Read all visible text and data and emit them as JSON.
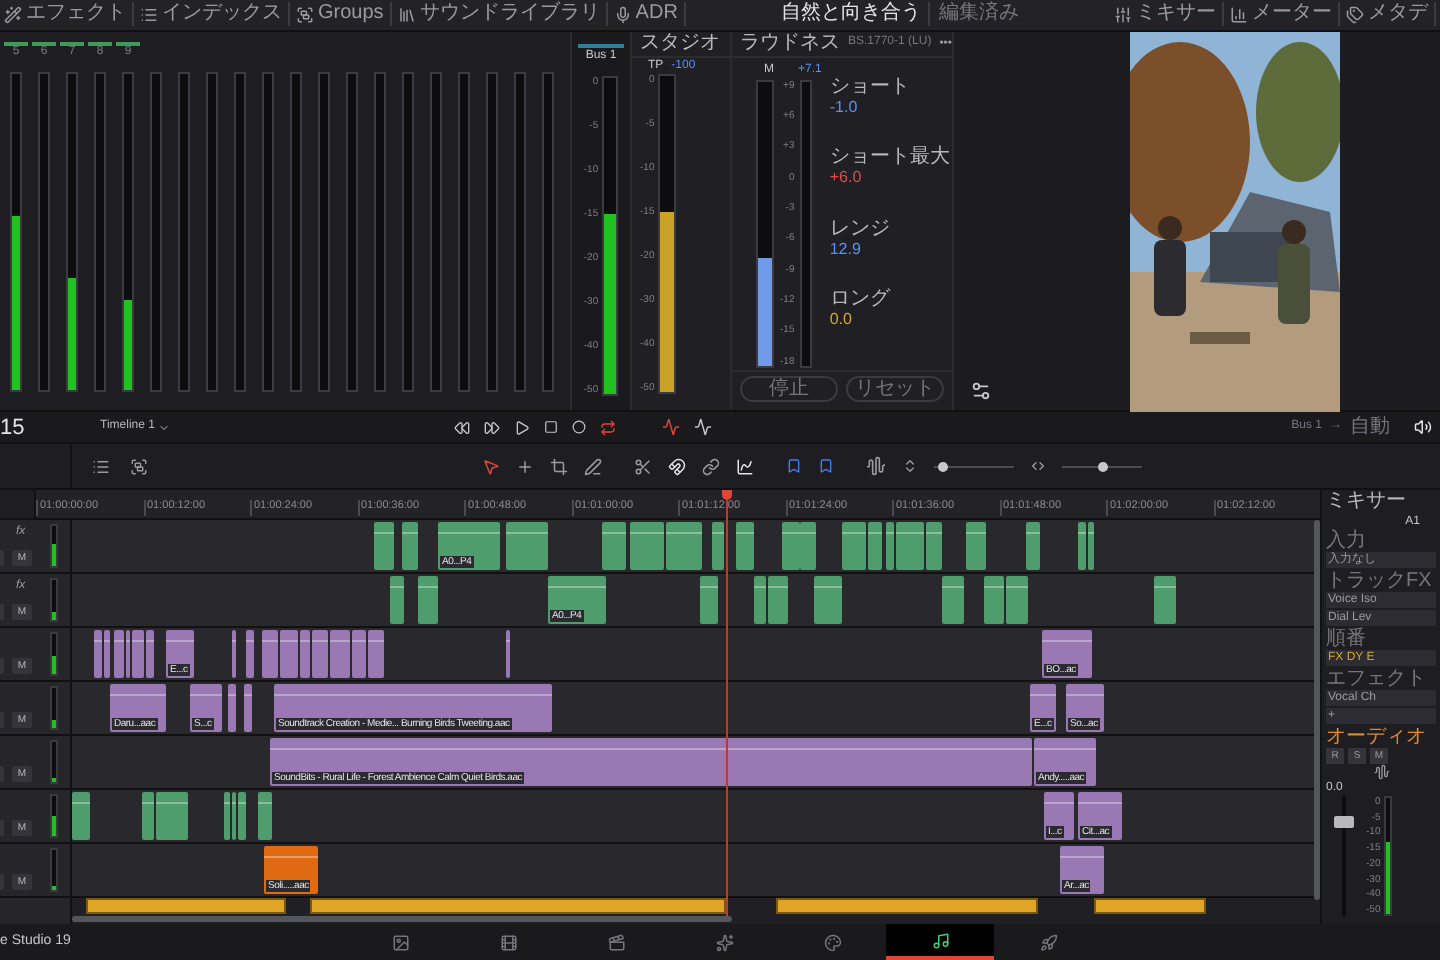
{
  "toolbar": {
    "left": [
      {
        "kind": "effects",
        "label": "エフェクト"
      },
      {
        "kind": "index",
        "label": "インデックス"
      },
      {
        "kind": "groups",
        "label": "Groups"
      },
      {
        "kind": "library",
        "label": "サウンドライブラリ"
      },
      {
        "kind": "adr",
        "label": "ADR"
      }
    ],
    "title": "自然と向き合う",
    "status": "編集済み",
    "right": [
      {
        "kind": "mixer",
        "label": "ミキサー"
      },
      {
        "kind": "meters",
        "label": "メーター"
      },
      {
        "kind": "metadata",
        "label": "メタデ"
      }
    ]
  },
  "channel_meters": [
    {
      "label": "5",
      "level": 0.55
    },
    {
      "label": "6"
    },
    {
      "label": "7",
      "level": 0.35
    },
    {
      "label": "8"
    },
    {
      "label": "9",
      "level": 0.28
    }
  ],
  "bus_meter": {
    "name": "Bus 1",
    "level": 0.57,
    "scale": [
      "0",
      "-5",
      "-10",
      "-15",
      "-20",
      "-30",
      "-40",
      "-50"
    ]
  },
  "studio": {
    "title": "スタジオ",
    "tp_label": "TP",
    "tp_value": "-100",
    "level": 0.57,
    "scale": [
      "0",
      "-5",
      "-10",
      "-15",
      "-20",
      "-30",
      "-40",
      "-50"
    ]
  },
  "loudness": {
    "title": "ラウドネス",
    "standard": "BS.1770-1 (LU)",
    "more": "•••",
    "m_label": "M",
    "m_meter": {
      "level": 0.38
    },
    "value": "+7.1",
    "scale": [
      "+9",
      "+6",
      "+3",
      "0",
      "-3",
      "-6",
      "-9",
      "-12",
      "-15",
      "-18"
    ],
    "readouts": [
      {
        "label": "ショート",
        "value": "-1.0",
        "color": "#5b8ff9"
      },
      {
        "label": "ショート最大",
        "value": "+6.0",
        "color": "#e04848"
      },
      {
        "label": "レンジ",
        "value": "12.9",
        "color": "#5b8ff9"
      },
      {
        "label": "ロング",
        "value": "0.0",
        "color": "#d4a72c"
      }
    ],
    "buttons": [
      "停止",
      "リセット"
    ]
  },
  "transport": {
    "timecode": "15",
    "timeline": "Timeline 1",
    "bus": "Bus 1",
    "arrow": "→",
    "mode": "自動"
  },
  "zoom_sliders": [
    {
      "level": 0.05
    },
    {
      "level": 0.5
    }
  ],
  "ruler": [
    "01:00:00:00",
    "01:00:12:00",
    "01:00:24:00",
    "01:00:36:00",
    "01:00:48:00",
    "01:01:00:00",
    "01:01:12:00",
    "01:01:24:00",
    "01:01:36:00",
    "01:01:48:00",
    "01:02:00:00",
    "01:02:12:00"
  ],
  "tracks": [
    {
      "fx": "fx",
      "mute": "M",
      "meter": {
        "level": 0.55
      },
      "clips": [
        {
          "color": "#4f9d6c"
        },
        {
          "color": "#4f9d6c"
        },
        {
          "label": "A0...P4",
          "color": "#4f9d6c"
        },
        {
          "color": "#4f9d6c"
        },
        {
          "color": "#4f9d6c"
        },
        {
          "color": "#4f9d6c"
        },
        {
          "color": "#4f9d6c"
        },
        {
          "color": "#4f9d6c"
        },
        {
          "color": "#4f9d6c"
        },
        {
          "color": "#4f9d6c"
        },
        {
          "color": "#4f9d6c"
        },
        {
          "color": "#4f9d6c"
        },
        {
          "color": "#4f9d6c"
        },
        {
          "color": "#4f9d6c"
        },
        {
          "color": "#4f9d6c"
        },
        {
          "color": "#4f9d6c"
        },
        {
          "color": "#4f9d6c"
        },
        {
          "color": "#4f9d6c"
        },
        {
          "color": "#4f9d6c"
        },
        {
          "color": "#4f9d6c"
        }
      ]
    },
    {
      "fx": "fx",
      "mute": "M",
      "meter": {
        "level": 0.2
      },
      "clips": [
        {
          "color": "#4f9d6c"
        },
        {
          "color": "#4f9d6c"
        },
        {
          "label": "A0...P4",
          "color": "#4f9d6c"
        },
        {
          "color": "#4f9d6c"
        },
        {
          "color": "#4f9d6c"
        },
        {
          "color": "#4f9d6c"
        },
        {
          "color": "#4f9d6c"
        },
        {
          "color": "#4f9d6c"
        },
        {
          "color": "#4f9d6c"
        },
        {
          "color": "#4f9d6c"
        },
        {
          "color": "#4f9d6c"
        }
      ]
    },
    {
      "mute": "M",
      "meter": {
        "level": 0.45
      },
      "clips": [
        {
          "color": "#9a78b4"
        },
        {
          "color": "#9a78b4"
        },
        {
          "color": "#9a78b4"
        },
        {
          "color": "#9a78b4"
        },
        {
          "color": "#9a78b4"
        },
        {
          "color": "#9a78b4"
        },
        {
          "label": "E...c",
          "color": "#9a78b4"
        },
        {
          "color": "#9a78b4"
        },
        {
          "color": "#9a78b4"
        },
        {
          "color": "#9a78b4"
        },
        {
          "color": "#9a78b4"
        },
        {
          "color": "#9a78b4"
        },
        {
          "color": "#9a78b4"
        },
        {
          "color": "#9a78b4"
        },
        {
          "color": "#9a78b4"
        },
        {
          "color": "#9a78b4"
        },
        {
          "color": "#9a78b4"
        },
        {
          "label": "BO...ac",
          "color": "#9a78b4"
        }
      ]
    },
    {
      "mute": "M",
      "meter": {
        "level": 0.2
      },
      "clips": [
        {
          "label": "Daru...aac",
          "color": "#9a78b4"
        },
        {
          "label": "S...c",
          "color": "#9a78b4"
        },
        {
          "color": "#9a78b4"
        },
        {
          "color": "#9a78b4"
        },
        {
          "label": "Soundtrack Creation - Medie... Burning Birds Tweeting.aac",
          "color": "#9a78b4"
        },
        {
          "label": "E...c",
          "color": "#9a78b4"
        },
        {
          "label": "So...ac",
          "color": "#9a78b4"
        }
      ]
    },
    {
      "mute": "M",
      "meter": {
        "level": 0.1
      },
      "clips": [
        {
          "label": "SoundBits - Rural Life - Forest Ambience Calm Quiet Birds.aac",
          "color": "#9a78b4"
        },
        {
          "label": "Andy.....aac",
          "color": "#9a78b4"
        }
      ]
    },
    {
      "mute": "M",
      "meter": {
        "level": 0.5
      },
      "clips": [
        {
          "color": "#4f9d6c"
        },
        {
          "color": "#4f9d6c"
        },
        {
          "color": "#4f9d6c"
        },
        {
          "color": "#4f9d6c"
        },
        {
          "color": "#4f9d6c"
        },
        {
          "color": "#4f9d6c"
        },
        {
          "color": "#4f9d6c"
        },
        {
          "label": "I...c",
          "color": "#9a78b4"
        },
        {
          "label": "Cit...ac",
          "color": "#9a78b4"
        }
      ]
    },
    {
      "mute": "M",
      "meter": {
        "level": 0.1
      },
      "clips": [
        {
          "label": "Soli.....aac",
          "color": "#e06a12"
        },
        {
          "label": "Ar...ac",
          "color": "#9a78b4"
        }
      ]
    }
  ],
  "mixer": {
    "title": "ミキサー",
    "channel": "A1",
    "rows": [
      {
        "label": "入力",
        "values": [
          "入力なし"
        ]
      },
      {
        "label": "トラックFX",
        "values": [
          "Voice Iso",
          "Dial Lev"
        ]
      },
      {
        "label": "順番",
        "values": [
          "FX DY E"
        ]
      },
      {
        "label": "エフェクト",
        "values": [
          "Vocal Ch",
          "+"
        ]
      }
    ],
    "section": "オーディオ",
    "buttons": [
      "R",
      "S",
      "M"
    ],
    "fader_value": "0.0",
    "fader": {
      "level": 0.78
    },
    "meter": {
      "level": 0.62
    },
    "scale": [
      "0",
      "-5",
      "-10",
      "-15",
      "-20",
      "-30",
      "-40",
      "-50"
    ]
  },
  "bottom": {
    "app": "e Studio 19",
    "pages": [
      {
        "kind": "media",
        "selected": false
      },
      {
        "kind": "cut",
        "selected": false
      },
      {
        "kind": "edit",
        "selected": false
      },
      {
        "kind": "fusion",
        "selected": false
      },
      {
        "kind": "color",
        "selected": false
      },
      {
        "kind": "fairlight",
        "selected": true
      },
      {
        "kind": "deliver",
        "selected": false
      }
    ]
  }
}
